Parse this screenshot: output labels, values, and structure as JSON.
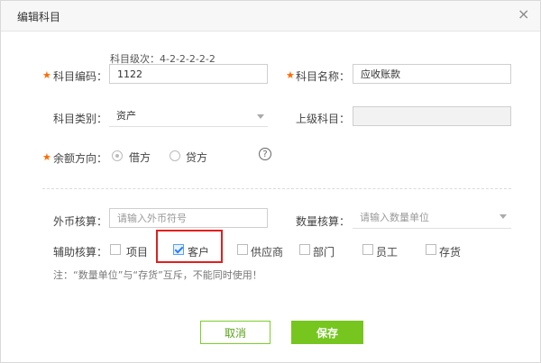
{
  "dialog": {
    "title": "编辑科目",
    "close_glyph": "×"
  },
  "form": {
    "level_hint": "科目级次：4-2-2-2-2-2",
    "code": {
      "label": "科目编码：",
      "value": "1122"
    },
    "name": {
      "label": "科目名称：",
      "value": "应收账款"
    },
    "category": {
      "label": "科目类别：",
      "value": "资产"
    },
    "parent": {
      "label": "上级科目：",
      "value": ""
    },
    "balance_direction": {
      "label": "余额方向：",
      "options": [
        {
          "label": "借方",
          "selected": true
        },
        {
          "label": "贷方",
          "selected": false
        }
      ],
      "help_glyph": "?"
    },
    "currency": {
      "label": "外币核算：",
      "placeholder": "请输入外币符号"
    },
    "quantity": {
      "label": "数量核算：",
      "placeholder": "请输入数量单位"
    },
    "aux": {
      "label": "辅助核算：",
      "items": [
        {
          "label": "项目",
          "checked": false
        },
        {
          "label": "客户",
          "checked": true
        },
        {
          "label": "供应商",
          "checked": false
        },
        {
          "label": "部门",
          "checked": false
        },
        {
          "label": "员工",
          "checked": false
        },
        {
          "label": "存货",
          "checked": false
        }
      ]
    },
    "note": "注：“数量单位”与“存货”互斥，不能同时使用！"
  },
  "buttons": {
    "cancel": "取消",
    "save": "保存"
  },
  "colors": {
    "required_star": "#ff6a00",
    "primary_green": "#76c61f",
    "highlight_red": "#e02020",
    "checkbox_blue": "#2d7ff9"
  }
}
